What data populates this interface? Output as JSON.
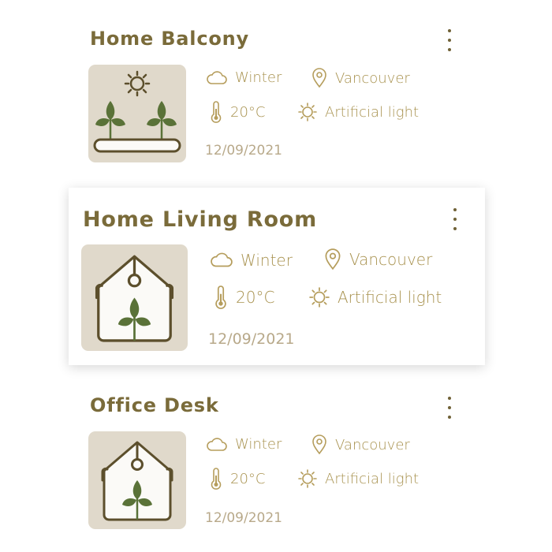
{
  "cards": [
    {
      "title": "Home Balcony",
      "thumbnail_icon": "sun-planter-icon",
      "season": "Winter",
      "location": "Vancouver",
      "temperature": "20°C",
      "light": "Artificial light",
      "date": "12/09/2021"
    },
    {
      "title": "Home Living Room",
      "thumbnail_icon": "greenhouse-icon",
      "season": "Winter",
      "location": "Vancouver",
      "temperature": "20°C",
      "light": "Artificial light",
      "date": "12/09/2021"
    },
    {
      "title": "Office Desk",
      "thumbnail_icon": "greenhouse-icon",
      "season": "Winter",
      "location": "Vancouver",
      "temperature": "20°C",
      "light": "Artificial light",
      "date": "12/09/2021"
    }
  ],
  "colors": {
    "title": "#7a6b3a",
    "info_text": "#a8924f",
    "date_text": "#b8a98a",
    "thumbnail_bg": "#e0d9cb",
    "leaf_green": "#5a7238",
    "outline_dark": "#5c4f2c"
  }
}
